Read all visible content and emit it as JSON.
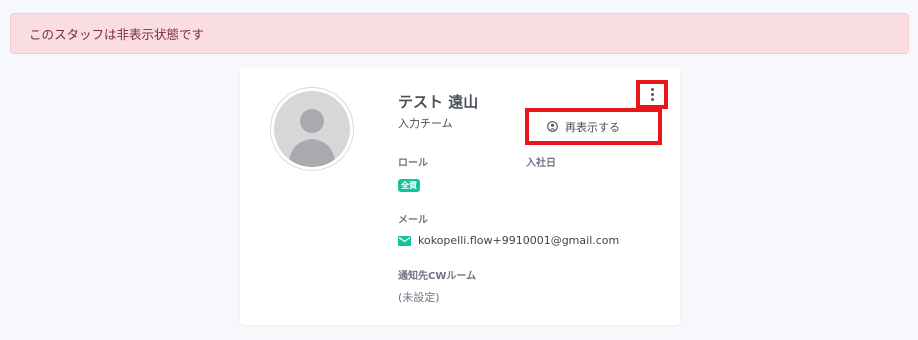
{
  "alert": {
    "text": "このスタッフは非表示状態です"
  },
  "profile": {
    "name": "テスト 遠山",
    "team": "入力チーム",
    "role_label": "ロール",
    "join_date_label": "入社日",
    "role_badge": "全資",
    "email_label": "メール",
    "email": "kokopelli.flow+9910001@gmail.com",
    "cw_room_label": "通知先CWルーム",
    "cw_room_value": "(未設定)"
  },
  "menu": {
    "redisplay_label": "再表示する"
  },
  "colors": {
    "alert_bg": "#fadde3",
    "alert_text": "#7a2b3c",
    "badge": "#13c39c",
    "highlight": "#e8151b"
  },
  "icons": {
    "avatar": "user-placeholder-icon",
    "kebab": "more-vertical-icon",
    "mail": "mail-icon",
    "redisplay": "user-circle-icon"
  }
}
